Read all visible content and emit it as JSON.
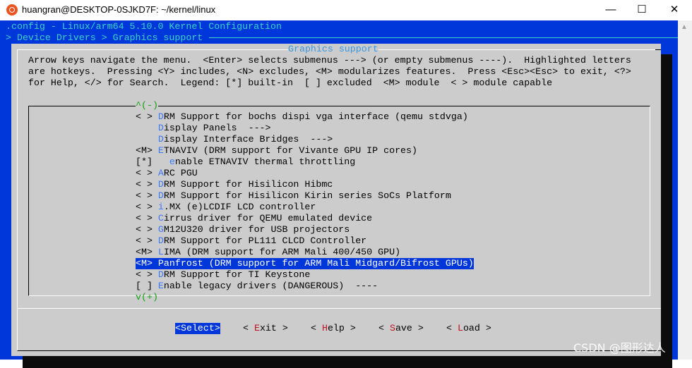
{
  "window": {
    "title": "huangran@DESKTOP-0SJKD7F: ~/kernel/linux",
    "controls": [
      "minimize",
      "maximize",
      "close"
    ]
  },
  "header": {
    "config_line": ".config - Linux/arm64 5.10.0 Kernel Configuration",
    "breadcrumb": "> Device Drivers > Graphics support"
  },
  "dialog": {
    "title": "Graphics support",
    "help": [
      "Arrow keys navigate the menu.  <Enter> selects submenus ---> (or empty submenus ----).  Highlighted letters",
      "are hotkeys.  Pressing <Y> includes, <N> excludes, <M> modularizes features.  Press <Esc><Esc> to exit, <?>",
      "for Help, </> for Search.  Legend: [*] built-in  [ ] excluded  <M> module  < > module capable"
    ],
    "scroll_up": "^(-)",
    "scroll_down": "v(+)",
    "items": [
      {
        "prefix": "< > ",
        "hotkey": "D",
        "rest": "RM Support for bochs dispi vga interface (qemu stdvga)"
      },
      {
        "prefix": "    ",
        "hotkey": "D",
        "rest": "isplay Panels  --->"
      },
      {
        "prefix": "    ",
        "hotkey": "D",
        "rest": "isplay Interface Bridges  --->"
      },
      {
        "prefix": "<M> ",
        "hotkey": "E",
        "rest": "TNAVIV (DRM support for Vivante GPU IP cores)"
      },
      {
        "prefix": "[*]   ",
        "hotkey": "e",
        "rest": "nable ETNAVIV thermal throttling"
      },
      {
        "prefix": "< > ",
        "hotkey": "A",
        "rest": "RC PGU"
      },
      {
        "prefix": "< > ",
        "hotkey": "D",
        "rest": "RM Support for Hisilicon Hibmc"
      },
      {
        "prefix": "< > ",
        "hotkey": "D",
        "rest": "RM Support for Hisilicon Kirin series SoCs Platform"
      },
      {
        "prefix": "< > ",
        "hotkey": "i",
        "rest": ".MX (e)LCDIF LCD controller"
      },
      {
        "prefix": "< > ",
        "hotkey": "C",
        "rest": "irrus driver for QEMU emulated device"
      },
      {
        "prefix": "< > ",
        "hotkey": "G",
        "rest": "M12U320 driver for USB projectors"
      },
      {
        "prefix": "< > ",
        "hotkey": "D",
        "rest": "RM Support for PL111 CLCD Controller"
      },
      {
        "prefix": "<M> ",
        "hotkey": "L",
        "rest": "IMA (DRM support for ARM Mali 400/450 GPU)"
      },
      {
        "prefix": "<M> ",
        "hotkey": "P",
        "rest": "anfrost (DRM support for ARM Mali Midgard/Bifrost GPUs)",
        "selected": true
      },
      {
        "prefix": "< > ",
        "hotkey": "D",
        "rest": "RM Support for TI Keystone"
      },
      {
        "prefix": "[ ] ",
        "hotkey": "E",
        "rest": "nable legacy drivers (DANGEROUS)  ----"
      }
    ],
    "buttons": [
      {
        "label": "<Select>",
        "selected": true
      },
      {
        "pre": "< ",
        "hotkey": "E",
        "rest": "xit",
        " post": " >"
      },
      {
        "pre": "< ",
        "hotkey": "H",
        "rest": "elp",
        "post": " >"
      },
      {
        "pre": "< ",
        "hotkey": "S",
        "rest": "ave",
        "post": " >"
      },
      {
        "pre": "< ",
        "hotkey": "L",
        "rest": "oad",
        "post": " >"
      }
    ]
  },
  "watermark": "CSDN @图形达人",
  "colors": {
    "terminal_bg": "#0037da",
    "dialog_bg": "#cccccc",
    "hotkey": "#3b78ff",
    "button_hotkey": "#c50f1f",
    "scroll_indicator": "#13a10e",
    "header_text": "#3ad3c4"
  }
}
